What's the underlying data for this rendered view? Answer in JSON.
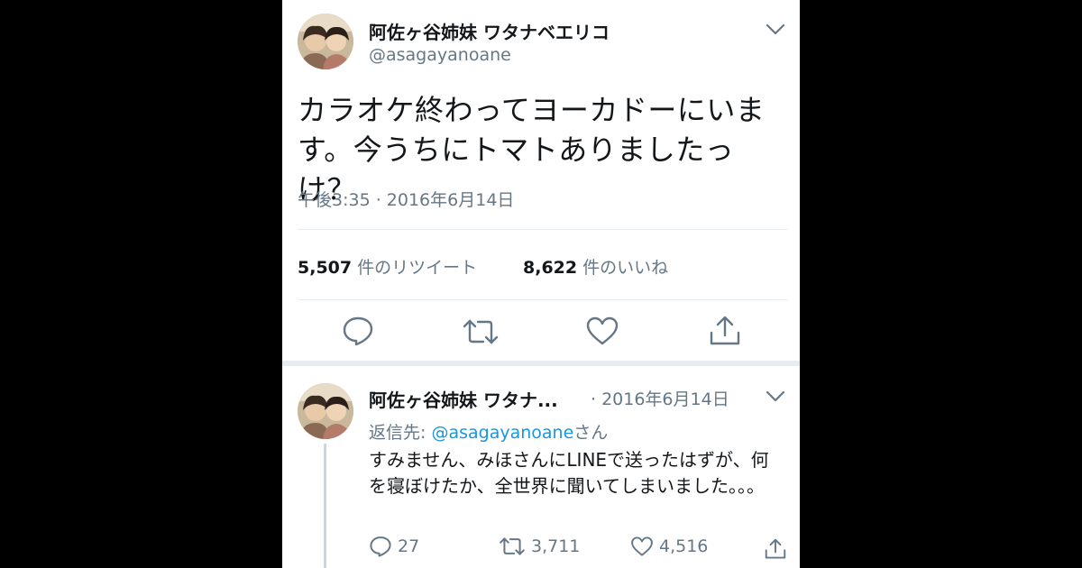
{
  "main_tweet": {
    "display_name": "阿佐ヶ谷姉妹 ワタナベエリコ",
    "handle": "@asagayanoane",
    "text": "カラオケ終わってヨーカドーにいます。今うちにトマトありましたっけ？",
    "timestamp": "午後3:35 · 2016年6月14日",
    "retweet_count": "5,507",
    "retweet_label": "件のリツイート",
    "like_count": "8,622",
    "like_label": "件のいいね",
    "icons": [
      "reply-icon",
      "retweet-icon",
      "like-icon",
      "share-icon"
    ]
  },
  "reply_tweet": {
    "display_name": "阿佐ヶ谷姉妹 ワタナ...",
    "date": "· 2016年6月14日",
    "reply_prefix": "返信先: ",
    "reply_handle": "@asagayanoane",
    "reply_suffix": "さん",
    "text": "すみません、みほさんにLINEで送ったはずが、何を寝ぼけたか、全世界に聞いてしまいました。。。",
    "reply_count": "27",
    "retweet_count": "3,711",
    "like_count": "4,516"
  },
  "colors": {
    "background": "#000000",
    "card": "#ffffff",
    "text": "#14171a",
    "secondary": "#657786",
    "link": "#1b95e0",
    "divider": "#e6ecf0"
  }
}
